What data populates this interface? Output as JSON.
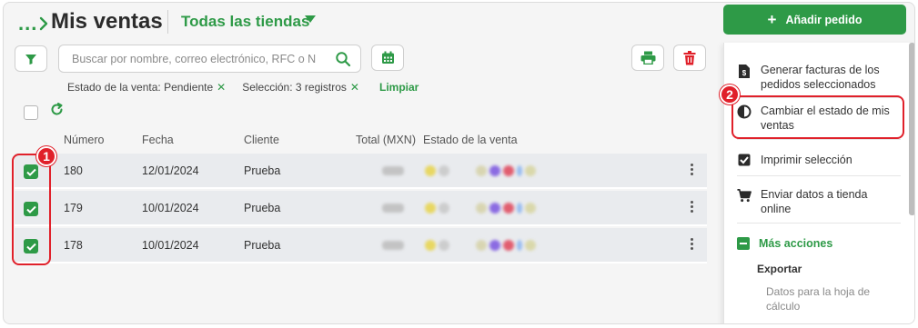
{
  "header": {
    "breadcrumb": "...",
    "title": "Mis ventas",
    "store_selector": "Todas las tiendas"
  },
  "toolbar": {
    "search_placeholder": "Buscar por nombre, correo electrónico, RFC o N",
    "filter_icon": "filter-icon",
    "calendar_icon": "calendar-icon",
    "print_icon": "printer-icon",
    "delete_icon": "trash-icon"
  },
  "filters": {
    "chips": [
      {
        "label": "Estado de la venta: Pendiente"
      },
      {
        "label": "Selección: 3 registros"
      }
    ],
    "remove_glyph": "✕",
    "clear_label": "Limpiar"
  },
  "table": {
    "columns": [
      "Número",
      "Fecha",
      "Cliente",
      "Total (MXN)",
      "Estado de la venta"
    ],
    "rows": [
      {
        "numero": "180",
        "fecha": "12/01/2024",
        "cliente": "Prueba",
        "checked": true
      },
      {
        "numero": "179",
        "fecha": "10/01/2024",
        "cliente": "Prueba",
        "checked": true
      },
      {
        "numero": "178",
        "fecha": "10/01/2024",
        "cliente": "Prueba",
        "checked": true
      }
    ]
  },
  "actions": {
    "add_order": "Añadir pedido",
    "add_glyph": "+",
    "menu": [
      {
        "label": "Generar facturas de los pedidos seleccionados",
        "icon": "invoice-icon"
      },
      {
        "label": "Cambiar el estado de mis ventas",
        "icon": "half-circle-icon"
      },
      {
        "label": "Imprimir selección",
        "icon": "checkbox-icon"
      },
      {
        "label": "Enviar datos a tienda online",
        "icon": "cart-icon"
      }
    ],
    "more_actions": "Más acciones",
    "export_heading": "Exportar",
    "export_sheet": "Datos para la hoja de cálculo"
  },
  "annotations": {
    "badge_1": "1",
    "badge_2": "2",
    "color": "#e0202a"
  },
  "colors": {
    "accent": "#2e9a47",
    "annotation": "#e0202a",
    "row_bg": "#e9ebee"
  }
}
